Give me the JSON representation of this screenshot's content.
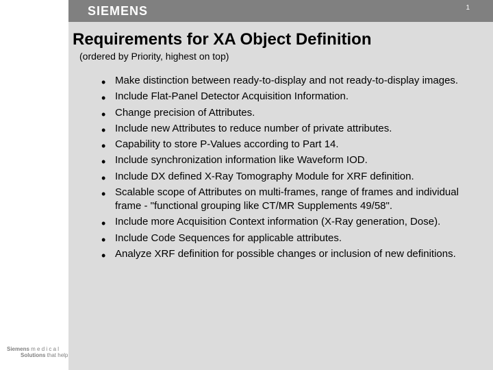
{
  "header": {
    "brand": "SIEMENS",
    "page_number": "1"
  },
  "main": {
    "title": "Requirements for XA Object Definition",
    "subtitle": "(ordered by Priority, highest on top)",
    "bullets": [
      "Make distinction between ready-to-display and not ready-to-display images.",
      "Include Flat-Panel Detector Acquisition Information.",
      "Change precision of Attributes.",
      "Include new Attributes to reduce number of private attributes.",
      "Capability to store P-Values according to Part 14.",
      "Include synchronization information like Waveform IOD.",
      "Include DX defined X-Ray Tomography Module for XRF definition.",
      "Scalable scope of Attributes on multi-frames, range of frames and individual frame - \"functional grouping like CT/MR Supplements 49/58\".",
      "Include more Acquisition Context information (X-Ray generation, Dose).",
      "Include Code Sequences for applicable attributes.",
      "Analyze XRF definition for possible changes or inclusion of new definitions."
    ]
  },
  "footer": {
    "line1_bold": "Siemens",
    "line1_light": " m e d i c a l",
    "line2_bold": "Solutions",
    "line2_light": " that help"
  }
}
